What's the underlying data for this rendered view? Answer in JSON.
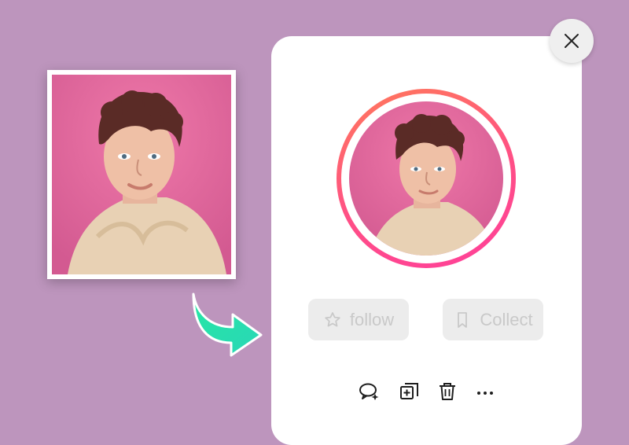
{
  "buttons": {
    "follow_label": "follow",
    "collect_label": "Collect"
  },
  "icons": {
    "close": "close-icon",
    "follow": "star-icon",
    "collect": "bookmark-icon",
    "comment": "comment-icon",
    "add": "add-to-collection-icon",
    "delete": "trash-icon",
    "more": "more-icon"
  },
  "colors": {
    "background": "#bd95bd",
    "avatar_ring_start": "#ff7a5a",
    "avatar_ring_end": "#ff3f9a",
    "arrow_start": "#25e7a4",
    "arrow_end": "#2ad6b7",
    "photo_bg": "#d85f95"
  }
}
